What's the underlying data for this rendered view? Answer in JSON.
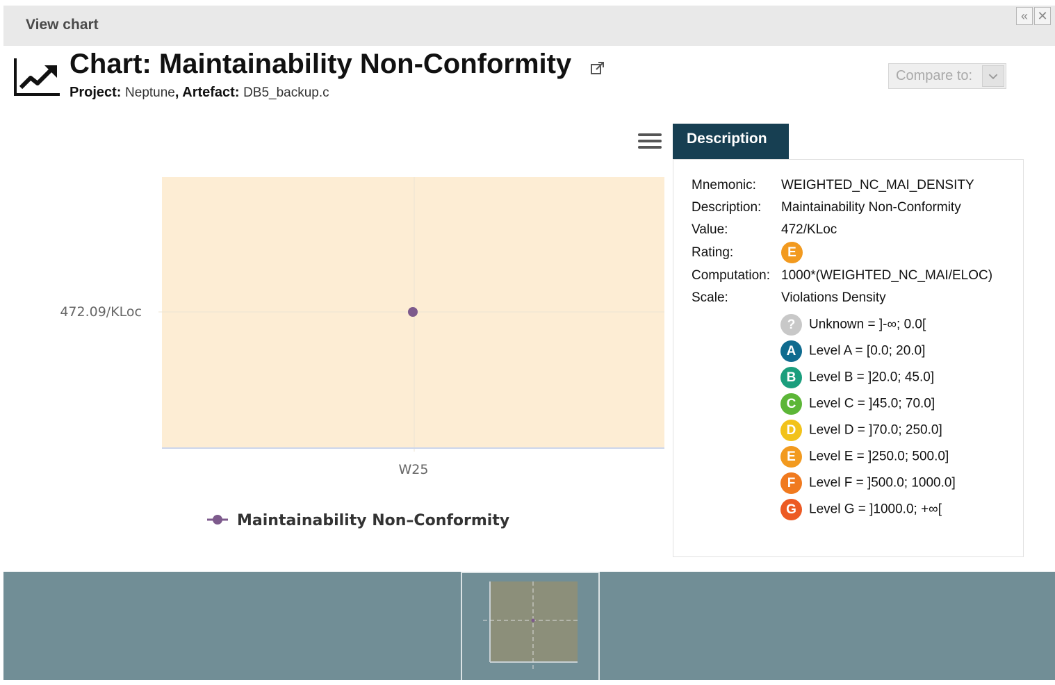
{
  "window": {
    "title": "View chart",
    "collapse_glyph": "«",
    "close_glyph": "✕"
  },
  "header": {
    "icon": "trend-chart-icon",
    "title": "Chart: Maintainability Non-Conformity",
    "external_link_icon": "external-link-icon",
    "project_label": "Project:",
    "project_value": "Neptune",
    "artefact_label": "Artefact:",
    "artefact_value": "DB5_backup.c",
    "compare_label": "Compare to:"
  },
  "chart_data": {
    "type": "scatter",
    "categories": [
      "W25"
    ],
    "series": [
      {
        "name": "Maintainability Non–Conformity",
        "values": [
          472.09
        ],
        "color": "#7d5a8c"
      }
    ],
    "y_tick_labels": [
      "472.09/KLoc"
    ],
    "background_color": "#fdedd4",
    "legend_position": "bottom-center",
    "grid": true
  },
  "description": {
    "tab_label": "Description",
    "rows": [
      {
        "key": "Mnemonic:",
        "value": "WEIGHTED_NC_MAI_DENSITY"
      },
      {
        "key": "Description:",
        "value": "Maintainability Non-Conformity"
      },
      {
        "key": "Value:",
        "value": "472/KLoc"
      },
      {
        "key": "Rating:",
        "value": "E"
      },
      {
        "key": "Computation:",
        "value": "1000*(WEIGHTED_NC_MAI/ELOC)"
      },
      {
        "key": "Scale:",
        "value": "Violations Density"
      }
    ],
    "rating_color": "#f29a1f",
    "scale": [
      {
        "badge": "?",
        "text": "Unknown = ]-∞; 0.0[",
        "color": "#c8c8c8"
      },
      {
        "badge": "A",
        "text": "Level A = [0.0; 20.0]",
        "color": "#0f6b8f"
      },
      {
        "badge": "B",
        "text": "Level B = ]20.0; 45.0]",
        "color": "#1b9e7d"
      },
      {
        "badge": "C",
        "text": "Level C = ]45.0; 70.0]",
        "color": "#5cb637"
      },
      {
        "badge": "D",
        "text": "Level D = ]70.0; 250.0]",
        "color": "#f2c21a"
      },
      {
        "badge": "E",
        "text": "Level E = ]250.0; 500.0]",
        "color": "#f29a1f"
      },
      {
        "badge": "F",
        "text": "Level F = ]500.0; 1000.0]",
        "color": "#f07a1f"
      },
      {
        "badge": "G",
        "text": "Level G = ]1000.0; +∞[",
        "color": "#ec5a24"
      }
    ]
  }
}
